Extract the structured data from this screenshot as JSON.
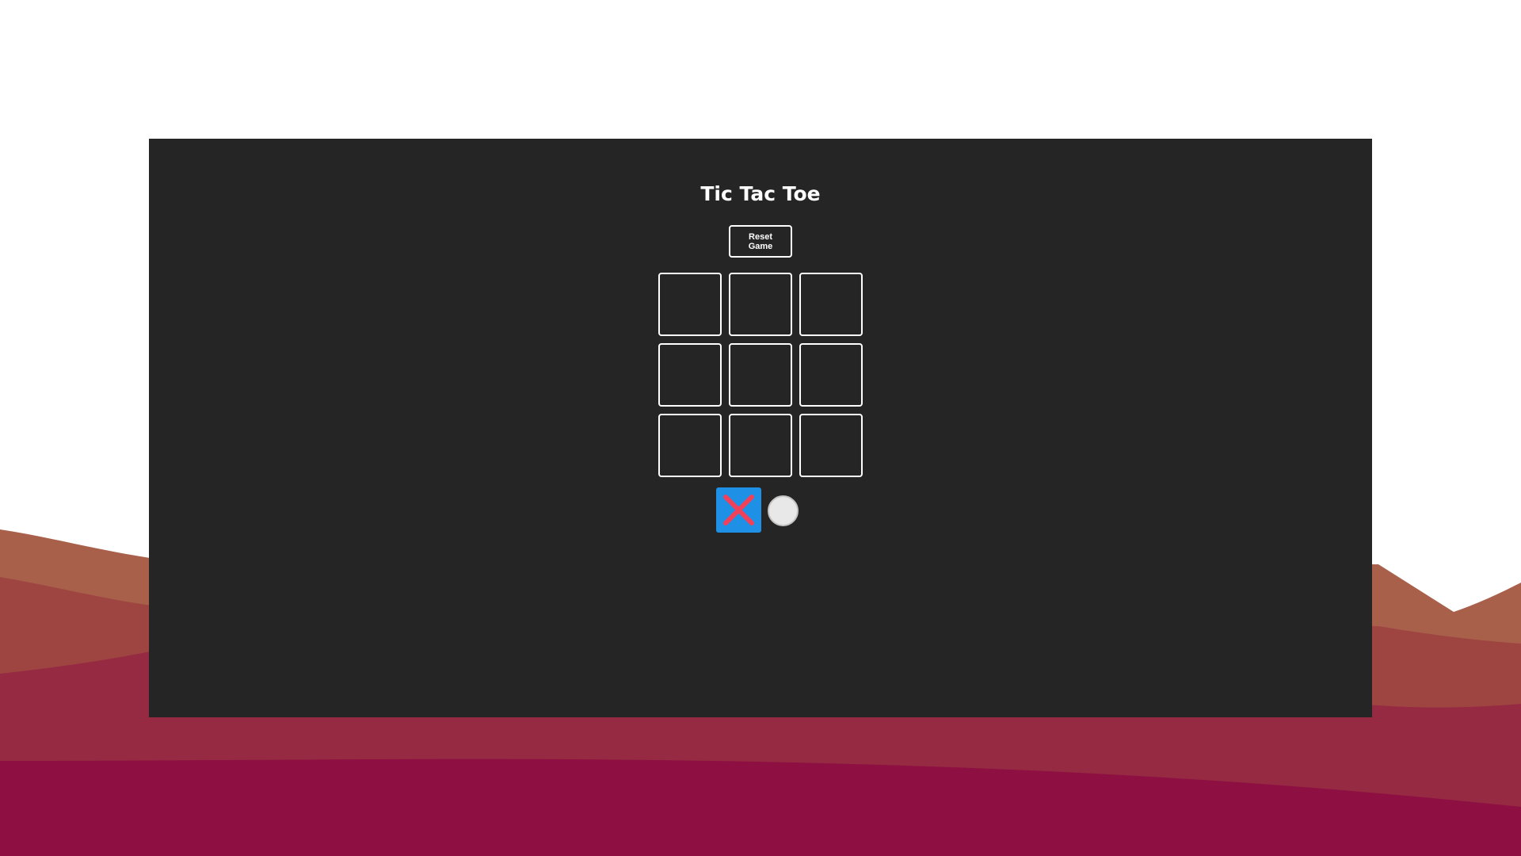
{
  "app": {
    "title": "Tic Tac Toe"
  },
  "controls": {
    "reset_label": "Reset Game"
  },
  "board": {
    "cells": [
      "",
      "",
      "",
      "",
      "",
      "",
      "",
      "",
      ""
    ]
  },
  "players": [
    {
      "symbol": "X",
      "icon": "x-mark-icon",
      "selected": true,
      "color": "#f0405a",
      "background": "#1e90e6"
    },
    {
      "symbol": "O",
      "icon": "circle-icon",
      "selected": false,
      "color": "#e8e8e8"
    }
  ],
  "colors": {
    "panel_background": "#252525",
    "page_background": "#ffffff",
    "wave_light": "#a8604a",
    "wave_mid": "#9a3c40",
    "wave_dark": "#8e0f42"
  }
}
